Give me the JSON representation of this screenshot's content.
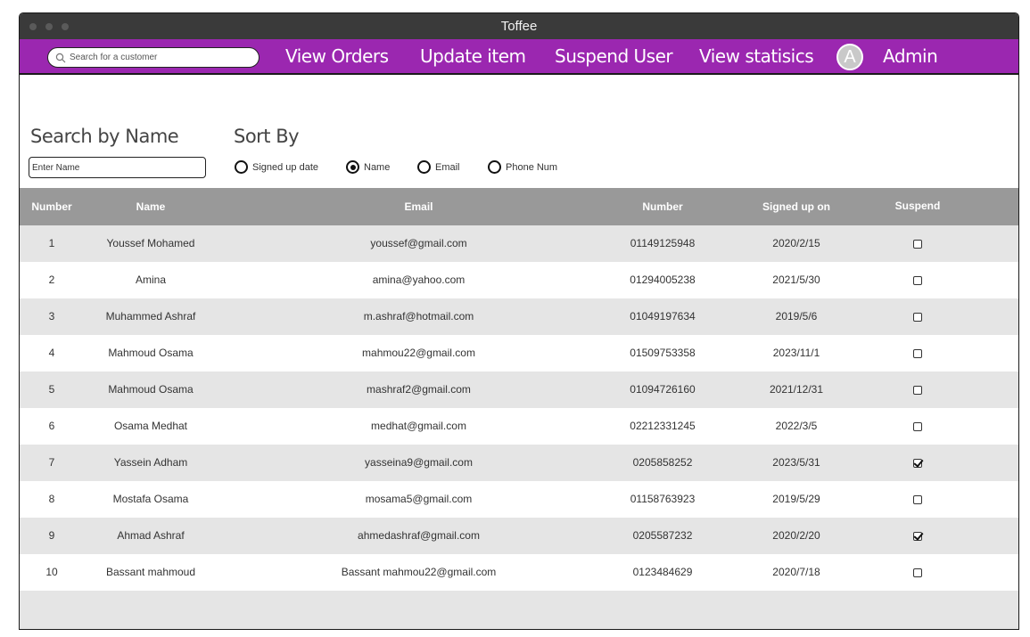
{
  "window": {
    "title": "Toffee"
  },
  "nav": {
    "search_placeholder": "Search for a customer",
    "links": [
      "View Orders",
      "Update item",
      "Suspend User",
      "View statisics"
    ],
    "avatar_letter": "A",
    "admin_label": "Admin"
  },
  "filters": {
    "search_label": "Search by Name",
    "name_placeholder": "Enter Name",
    "sort_label": "Sort By",
    "sort_options": [
      "Signed up date",
      "Name",
      "Email",
      "Phone Num"
    ],
    "sort_selected": "Name"
  },
  "colors": {
    "nav_bg": "#9b27b0",
    "titlebar": "#3a3a3a",
    "header_bg": "#999999",
    "row_alt": "#e5e5e5"
  },
  "table": {
    "columns": [
      "Number",
      "Name",
      "Email",
      "Number",
      "Signed up on",
      "Suspend"
    ],
    "rows": [
      {
        "num": "1",
        "name": "Youssef Mohamed",
        "email": "youssef@gmail.com",
        "phone": "01149125948",
        "date": "2020/2/15",
        "suspended": false
      },
      {
        "num": "2",
        "name": "Amina",
        "email": "amina@yahoo.com",
        "phone": "01294005238",
        "date": "2021/5/30",
        "suspended": false
      },
      {
        "num": "3",
        "name": "Muhammed Ashraf",
        "email": "m.ashraf@hotmail.com",
        "phone": "01049197634",
        "date": "2019/5/6",
        "suspended": false
      },
      {
        "num": "4",
        "name": "Mahmoud Osama",
        "email": "mahmou22@gmail.com",
        "phone": "01509753358",
        "date": "2023/11/1",
        "suspended": false
      },
      {
        "num": "5",
        "name": "Mahmoud Osama",
        "email": "mashraf2@gmail.com",
        "phone": "01094726160",
        "date": "2021/12/31",
        "suspended": false
      },
      {
        "num": "6",
        "name": "Osama Medhat",
        "email": "medhat@gmail.com",
        "phone": "02212331245",
        "date": "2022/3/5",
        "suspended": false
      },
      {
        "num": "7",
        "name": "Yassein Adham",
        "email": "yasseina9@gmail.com",
        "phone": "0205858252",
        "date": "2023/5/31",
        "suspended": true
      },
      {
        "num": "8",
        "name": "Mostafa Osama",
        "email": "mosama5@gmail.com",
        "phone": "01158763923",
        "date": "2019/5/29",
        "suspended": false
      },
      {
        "num": "9",
        "name": "Ahmad Ashraf",
        "email": "ahmedashraf@gmail.com",
        "phone": "0205587232",
        "date": "2020/2/20",
        "suspended": true
      },
      {
        "num": "10",
        "name": "Bassant mahmoud",
        "email": "Bassant mahmou22@gmail.com",
        "phone": "0123484629",
        "date": "2020/7/18",
        "suspended": false
      }
    ]
  }
}
